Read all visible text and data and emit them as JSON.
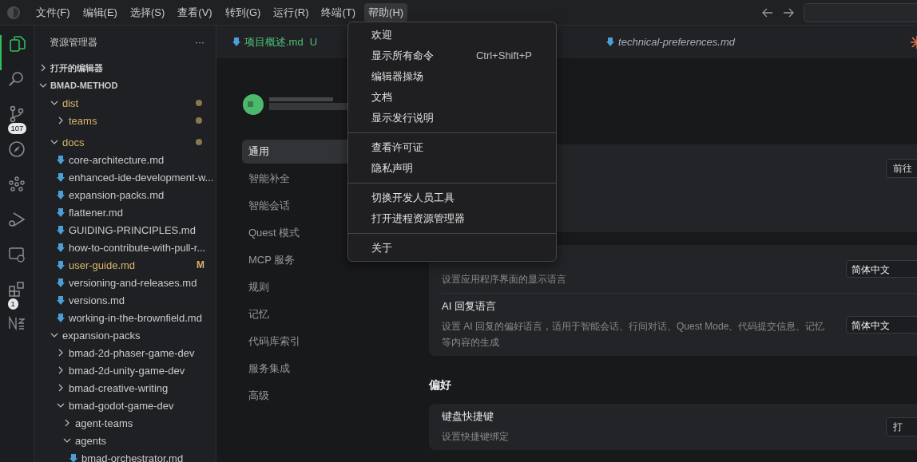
{
  "menubar": {
    "menus": [
      {
        "label": "文件(F)",
        "selected": false
      },
      {
        "label": "编辑(E)",
        "selected": false
      },
      {
        "label": "选择(S)",
        "selected": false
      },
      {
        "label": "查看(V)",
        "selected": false
      },
      {
        "label": "转到(G)",
        "selected": false
      },
      {
        "label": "运行(R)",
        "selected": false
      },
      {
        "label": "终端(T)",
        "selected": false
      },
      {
        "label": "帮助(H)",
        "selected": true
      }
    ]
  },
  "activity_bar": {
    "items": [
      {
        "kind": "explorer",
        "selected": true
      },
      {
        "kind": "search",
        "selected": false
      },
      {
        "kind": "source-control",
        "selected": false,
        "badge": "107"
      },
      {
        "kind": "compass",
        "selected": false
      },
      {
        "kind": "nodes",
        "selected": false
      },
      {
        "kind": "run-debug",
        "selected": false
      },
      {
        "kind": "remote",
        "selected": false
      },
      {
        "kind": "extensions",
        "selected": false,
        "badge": "1"
      },
      {
        "kind": "nx",
        "selected": false
      }
    ]
  },
  "explorer": {
    "title": "资源管理器",
    "more": "···",
    "sections": [
      {
        "label": "打开的编辑器",
        "expanded": false
      },
      {
        "label": "BMAD-METHOD",
        "expanded": true
      }
    ],
    "tree": [
      {
        "name": "dist",
        "kind": "folder",
        "expanded": true,
        "dot": true,
        "children": [
          {
            "name": "teams",
            "kind": "folder",
            "expanded": false,
            "dot": true
          }
        ]
      },
      {
        "name": "docs",
        "kind": "folder",
        "expanded": true,
        "dot": true,
        "children": [
          {
            "name": "core-architecture.md",
            "kind": "file",
            "dot": false
          },
          {
            "name": "enhanced-ide-development-w...",
            "kind": "file",
            "dot": false
          },
          {
            "name": "expansion-packs.md",
            "kind": "file",
            "dot": false
          },
          {
            "name": "flattener.md",
            "kind": "file",
            "dot": false
          },
          {
            "name": "GUIDING-PRINCIPLES.md",
            "kind": "file",
            "dot": false
          },
          {
            "name": "how-to-contribute-with-pull-r...",
            "kind": "file",
            "dot": false
          },
          {
            "name": "user-guide.md",
            "kind": "file",
            "dot": false,
            "badge": "M"
          },
          {
            "name": "versioning-and-releases.md",
            "kind": "file",
            "dot": false
          },
          {
            "name": "versions.md",
            "kind": "file",
            "dot": false
          },
          {
            "name": "working-in-the-brownfield.md",
            "kind": "file",
            "dot": false
          }
        ]
      },
      {
        "name": "expansion-packs",
        "kind": "folder",
        "expanded": true,
        "dot": false,
        "children": [
          {
            "name": "bmad-2d-phaser-game-dev",
            "kind": "folder",
            "expanded": false,
            "dot": false
          },
          {
            "name": "bmad-2d-unity-game-dev",
            "kind": "folder",
            "expanded": false,
            "dot": false
          },
          {
            "name": "bmad-creative-writing",
            "kind": "folder",
            "expanded": false,
            "dot": false
          },
          {
            "name": "bmad-godot-game-dev",
            "kind": "folder",
            "expanded": true,
            "dot": false,
            "children": [
              {
                "name": "agent-teams",
                "kind": "folder",
                "expanded": false,
                "dot": false
              },
              {
                "name": "agents",
                "kind": "folder",
                "expanded": true,
                "dot": false,
                "children": [
                  {
                    "name": "bmad-orchestrator.md",
                    "kind": "file",
                    "dot": false
                  }
                ]
              }
            ]
          }
        ]
      }
    ]
  },
  "editor_tabs": [
    {
      "label": "项目概述.md",
      "status": "U",
      "preview": false
    },
    {
      "label": "technical-preferences.md",
      "preview": true
    }
  ],
  "settings": {
    "nav": [
      {
        "label": "通用",
        "selected": true
      },
      {
        "label": "智能补全",
        "selected": false
      },
      {
        "label": "智能会话",
        "selected": false
      },
      {
        "label": "Quest 模式",
        "selected": false
      },
      {
        "label": "MCP 服务",
        "selected": false
      },
      {
        "label": "规则",
        "selected": false
      },
      {
        "label": "记忆",
        "selected": false
      },
      {
        "label": "代码库索引",
        "selected": false
      },
      {
        "label": "服务集成",
        "selected": false
      },
      {
        "label": "高级",
        "selected": false
      }
    ],
    "cards": [
      {
        "rows": [
          {
            "button": "前往"
          }
        ]
      },
      {
        "rows": [
          {
            "description": "设置应用程序界面的显示语言",
            "select": "简体中文"
          },
          {
            "title": "AI 回复语言",
            "description": "设置 AI 回复的偏好语言，适用于智能会话、行间对话、Quest Mode、代码提交信息、记忆等内容的生成",
            "select": "简体中文"
          }
        ]
      },
      {
        "heading": "偏好",
        "rows": [
          {
            "title": "键盘快捷键",
            "description": "设置快捷键绑定",
            "button": "打"
          }
        ]
      }
    ]
  },
  "help_menu": {
    "groups": [
      [
        {
          "label": "欢迎"
        },
        {
          "label": "显示所有命令",
          "shortcut": "Ctrl+Shift+P"
        },
        {
          "label": "编辑器操场"
        },
        {
          "label": "文档"
        },
        {
          "label": "显示发行说明"
        }
      ],
      [
        {
          "label": "查看许可证"
        },
        {
          "label": "隐私声明"
        }
      ],
      [
        {
          "label": "切换开发人员工具"
        },
        {
          "label": "打开进程资源管理器"
        }
      ],
      [
        {
          "label": "关于"
        }
      ]
    ]
  }
}
